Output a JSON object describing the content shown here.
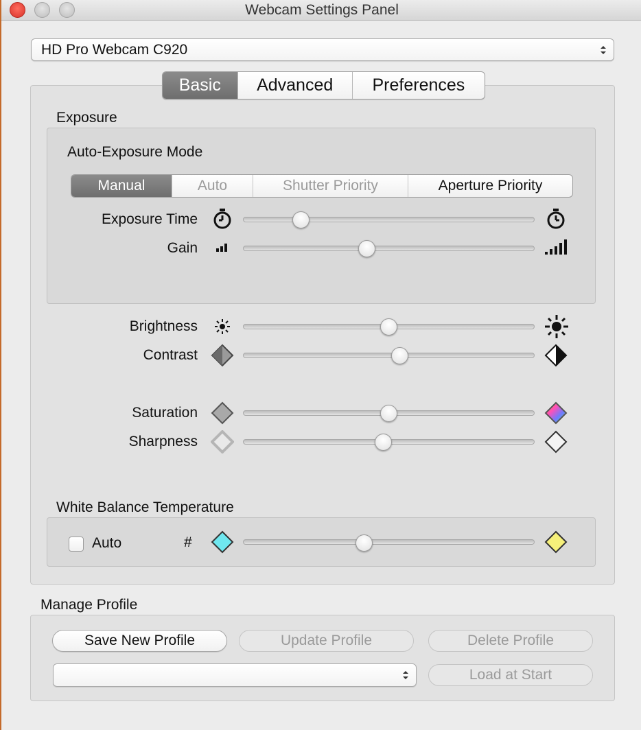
{
  "window": {
    "title": "Webcam Settings Panel"
  },
  "device": {
    "selected": "HD Pro Webcam C920"
  },
  "tabs": [
    {
      "label": "Basic",
      "active": true
    },
    {
      "label": "Advanced",
      "active": false
    },
    {
      "label": "Preferences",
      "active": false
    }
  ],
  "exposure": {
    "section_label": "Exposure",
    "mode_label": "Auto-Exposure Mode",
    "modes": [
      {
        "label": "Manual",
        "state": "active"
      },
      {
        "label": "Auto",
        "state": "disabled"
      },
      {
        "label": "Shutter Priority",
        "state": "disabled"
      },
      {
        "label": "Aperture Priority",
        "state": "enabled"
      }
    ],
    "exposure_time": {
      "label": "Exposure Time",
      "value": 0.18
    },
    "gain": {
      "label": "Gain",
      "value": 0.42
    }
  },
  "image": {
    "brightness": {
      "label": "Brightness",
      "value": 0.5
    },
    "contrast": {
      "label": "Contrast",
      "value": 0.54
    },
    "saturation": {
      "label": "Saturation",
      "value": 0.5
    },
    "sharpness": {
      "label": "Sharpness",
      "value": 0.48
    }
  },
  "white_balance": {
    "section_label": "White Balance Temperature",
    "auto_label": "Auto",
    "auto_checked": false,
    "hash_label": "#",
    "value": 0.41
  },
  "profile": {
    "section_label": "Manage Profile",
    "save_label": "Save New Profile",
    "update_label": "Update Profile",
    "delete_label": "Delete Profile",
    "load_label": "Load at Start",
    "selected": ""
  },
  "colors": {
    "accent_tab": "#7c7c7c",
    "wb_cool": "#6fe7ef",
    "wb_warm": "#f6f07a",
    "close_button": "#e0443a"
  }
}
